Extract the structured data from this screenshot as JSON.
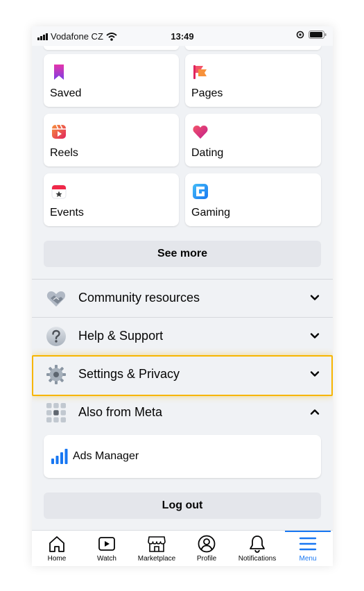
{
  "status_bar": {
    "carrier": "Vodafone CZ",
    "time": "13:49"
  },
  "shortcuts": [
    {
      "label": "Saved",
      "icon": "bookmark-icon"
    },
    {
      "label": "Pages",
      "icon": "flag-icon"
    },
    {
      "label": "Reels",
      "icon": "reels-icon"
    },
    {
      "label": "Dating",
      "icon": "heart-icon"
    },
    {
      "label": "Events",
      "icon": "calendar-star-icon"
    },
    {
      "label": "Gaming",
      "icon": "gaming-icon"
    }
  ],
  "see_more_label": "See more",
  "sections": {
    "community": "Community resources",
    "help": "Help & Support",
    "settings": "Settings & Privacy",
    "meta": "Also from Meta"
  },
  "ads_manager_label": "Ads Manager",
  "logout_label": "Log out",
  "tabs": [
    {
      "label": "Home",
      "icon": "home-icon"
    },
    {
      "label": "Watch",
      "icon": "watch-icon"
    },
    {
      "label": "Marketplace",
      "icon": "marketplace-icon"
    },
    {
      "label": "Profile",
      "icon": "profile-icon"
    },
    {
      "label": "Notifications",
      "icon": "bell-icon"
    },
    {
      "label": "Menu",
      "icon": "menu-icon"
    }
  ],
  "colors": {
    "accent": "#1877f2",
    "highlight": "#f7b500",
    "background": "#f0f2f5"
  }
}
